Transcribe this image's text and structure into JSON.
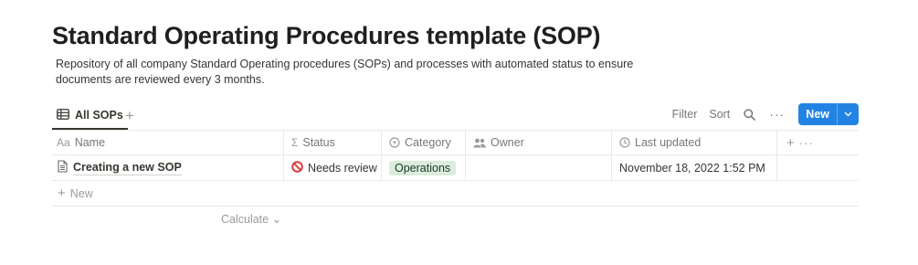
{
  "page": {
    "title": "Standard Operating Procedures template (SOP)",
    "description": "Repository of all company Standard Operating procedures (SOPs) and processes with automated status to ensure documents are reviewed every 3 months."
  },
  "view": {
    "tab_label": "All SOPs",
    "add_view": "+",
    "filter": "Filter",
    "sort": "Sort",
    "more": "···",
    "new_label": "New",
    "new_arrow": "⌄"
  },
  "table": {
    "columns": {
      "name": {
        "icon": "Aa",
        "label": "Name"
      },
      "status": {
        "icon": "Σ",
        "label": "Status"
      },
      "category": {
        "label": "Category"
      },
      "owner": {
        "label": "Owner"
      },
      "last_updated": {
        "label": "Last updated"
      },
      "add": "+",
      "more": "···"
    },
    "rows": [
      {
        "name": "Creating a new SOP",
        "status": "Needs review",
        "category": "Operations",
        "owner": "",
        "last_updated": "November 18, 2022 1:52 PM"
      }
    ],
    "new_row": {
      "plus": "+",
      "label": "New"
    },
    "calculate": "Calculate ⌄"
  },
  "colors": {
    "accent": "#2383e2",
    "tag_bg": "#dbeddb",
    "status_icon": "#e03e3e"
  },
  "icons": {
    "tab": "table-icon",
    "search": "search-icon",
    "category": "select-icon",
    "owner": "people-icon",
    "last_updated": "clock-icon",
    "row": "page-icon",
    "status": "no-entry-icon"
  }
}
